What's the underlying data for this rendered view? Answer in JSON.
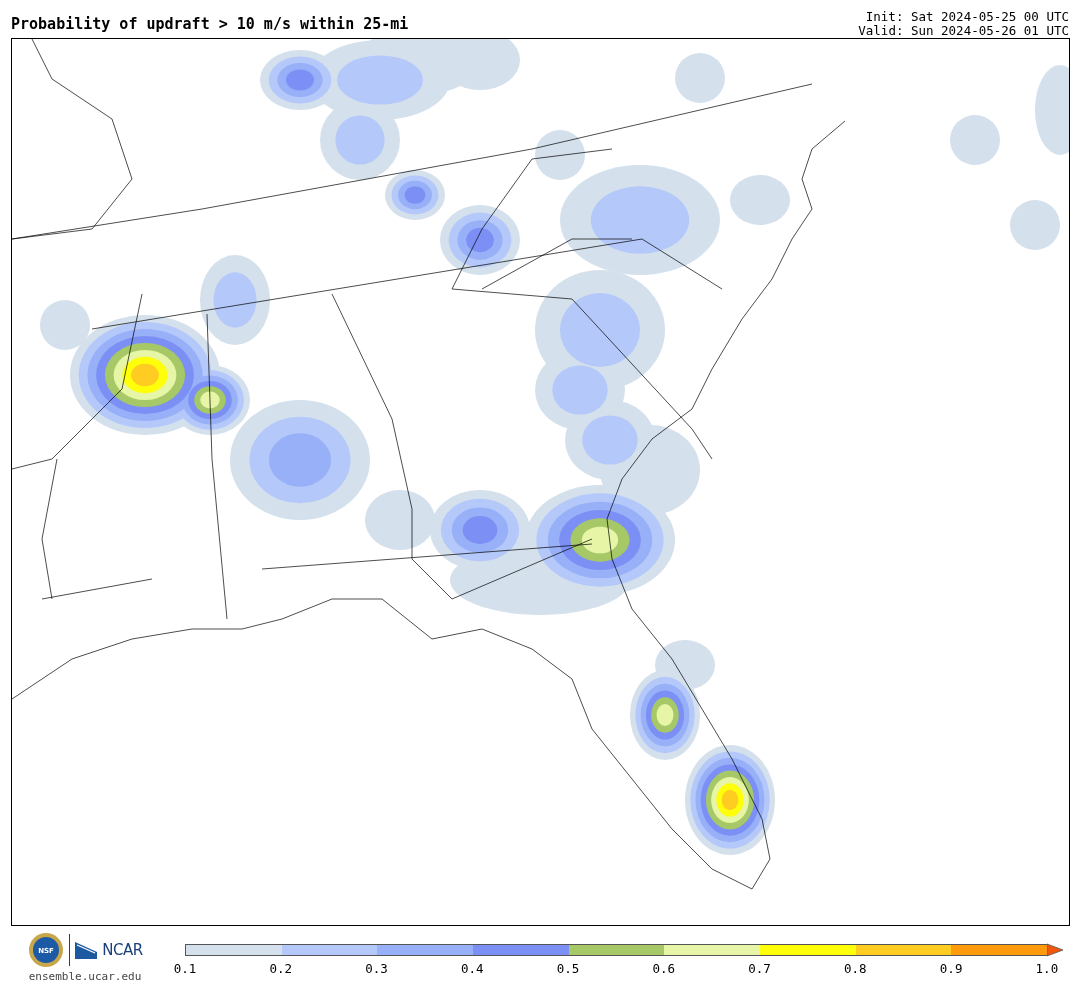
{
  "header": {
    "title": "Probability of updraft > 10 m/s within 25-mi",
    "init": "Init: Sat 2024-05-25 00 UTC",
    "valid": "Valid: Sun 2024-05-26 01 UTC"
  },
  "logos": {
    "nsf": "NSF",
    "ncar": "NCAR",
    "site": "ensemble.ucar.edu"
  },
  "colorbar": {
    "bins": [
      {
        "color": "#d4e0ec"
      },
      {
        "color": "#b4c8fa"
      },
      {
        "color": "#97b0f7"
      },
      {
        "color": "#7b8ff5"
      },
      {
        "color": "#a6c866"
      },
      {
        "color": "#e6f5a6"
      },
      {
        "color": "#ffff0a"
      },
      {
        "color": "#ffcd22"
      },
      {
        "color": "#ff9a0c"
      }
    ],
    "extend": {
      "color": "#f0560c"
    },
    "ticks": [
      "0.1",
      "0.2",
      "0.3",
      "0.4",
      "0.5",
      "0.6",
      "0.7",
      "0.8",
      "0.9",
      "1.0"
    ]
  }
}
